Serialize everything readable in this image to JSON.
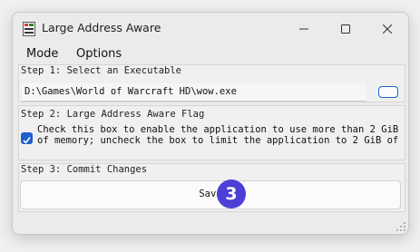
{
  "window": {
    "title": "Large Address Aware",
    "icon": "app-icon"
  },
  "menu": {
    "items": [
      {
        "label": "Mode"
      },
      {
        "label": "Options"
      }
    ]
  },
  "step1": {
    "legend": "Step 1: Select an Executable",
    "path_value": "D:\\Games\\World of Warcraft HD\\wow.exe",
    "browse_icon": "browse-icon"
  },
  "step2": {
    "legend": "Step 2: Large Address Aware Flag",
    "checked": true,
    "description": "Check this box to enable the application to use more than 2 GiB of memory; uncheck the box to limit the application to 2 GiB of"
  },
  "step3": {
    "legend": "Step 3: Commit Changes",
    "save_label": "Save",
    "badge": "3"
  },
  "colors": {
    "accent": "#1f5fcf",
    "badge": "#4b3fd6"
  }
}
